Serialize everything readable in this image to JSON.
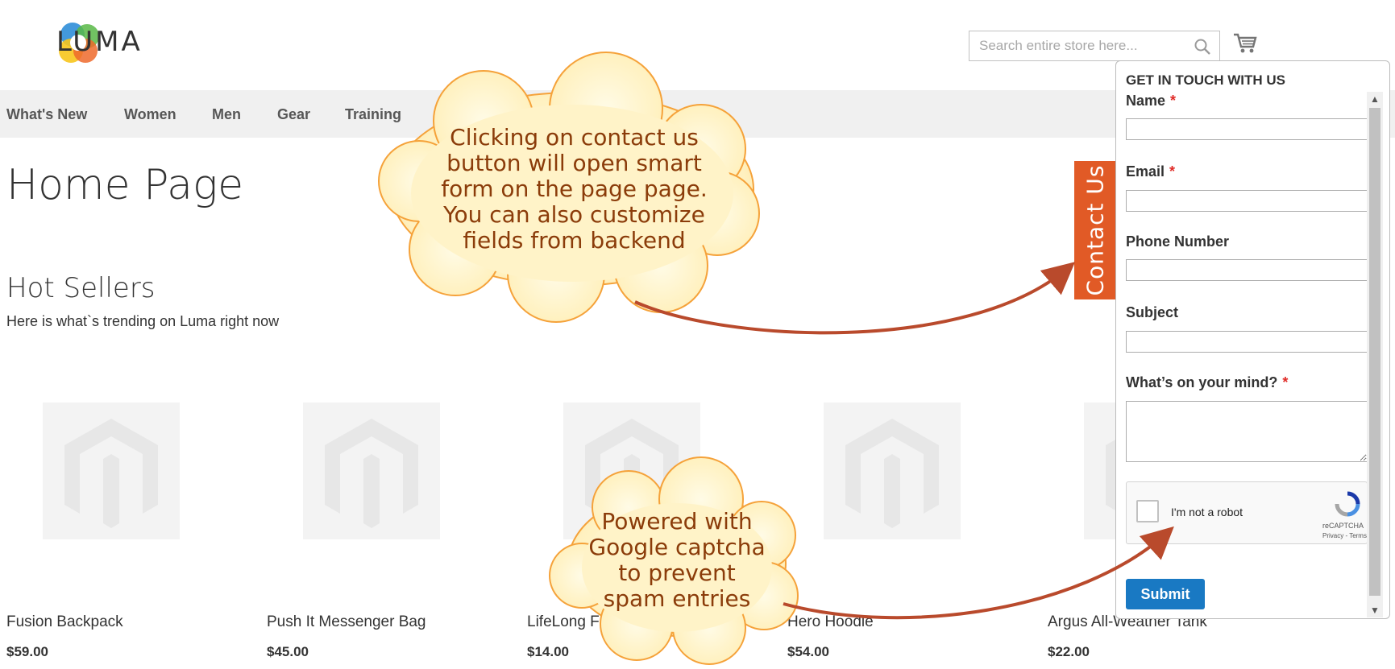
{
  "header": {
    "logo_text": "LUMA",
    "search_placeholder": "Search entire store here..."
  },
  "nav": {
    "items": [
      "What's New",
      "Women",
      "Men",
      "Gear",
      "Training"
    ]
  },
  "main": {
    "page_title": "Home Page",
    "section_title": "Hot Sellers",
    "section_subtitle": "Here is what`s trending on Luma right now",
    "products": [
      {
        "name": "Fusion Backpack",
        "price": "$59.00"
      },
      {
        "name": "Push It Messenger Bag",
        "price": "$45.00"
      },
      {
        "name": "LifeLong Fitness",
        "price": "$14.00"
      },
      {
        "name": "Hero Hoodie",
        "price": "$54.00"
      },
      {
        "name": "Argus All-Weather Tank",
        "price": "$22.00"
      }
    ]
  },
  "contact_tab": {
    "label": "Contact Us"
  },
  "contact_form": {
    "title": "GET IN TOUCH WITH US",
    "fields": [
      {
        "label": "Name",
        "required": "*"
      },
      {
        "label": "Email",
        "required": "*"
      },
      {
        "label": "Phone Number",
        "required": ""
      },
      {
        "label": "Subject",
        "required": ""
      },
      {
        "label": "What’s on your mind?",
        "required": "*"
      }
    ],
    "recaptcha_label": "I'm not a robot",
    "recaptcha_brand": "reCAPTCHA",
    "recaptcha_terms": "Privacy - Terms",
    "submit_label": "Submit"
  },
  "callouts": {
    "top": [
      "Clicking on contact us",
      "button will open smart",
      "form on the page page.",
      "You can also customize",
      "fields from backend"
    ],
    "bottom": [
      "Powered with",
      "Google captcha",
      "to prevent",
      "spam entries"
    ]
  },
  "colors": {
    "brand_orange": "#e15a26",
    "submit_blue": "#1979c3",
    "callout_fill": "#fff6c8",
    "callout_border": "#f5a23a",
    "arrow": "#b94a2c",
    "required_red": "#e02b27"
  }
}
